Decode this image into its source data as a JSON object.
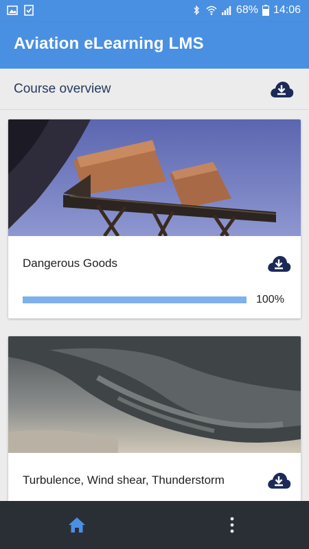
{
  "status_bar": {
    "battery": "68%",
    "time": "14:06",
    "left_icons": [
      "image-icon",
      "checkbox-icon"
    ],
    "right_icons": [
      "bluetooth-icon",
      "wifi-icon",
      "signal-icon",
      "battery-icon"
    ]
  },
  "app_bar": {
    "title": "Aviation eLearning LMS"
  },
  "overview": {
    "title": "Course overview",
    "download_icon": "cloud-download-icon"
  },
  "courses": [
    {
      "title": "Dangerous Goods",
      "progress": 1.0,
      "progress_label": "100%",
      "image": "cargo-loader-photo"
    },
    {
      "title": "Turbulence, Wind shear, Thunderstorm",
      "image": "storm-cloud-photo"
    }
  ],
  "bottom_nav": {
    "items": [
      "home-icon",
      "more-vert-icon"
    ]
  },
  "colors": {
    "primary": "#4a90e2",
    "accent_dark": "#1c2a57",
    "progress": "#7fb0ee",
    "nav_bg": "#2a2f36",
    "nav_active": "#4a90e2"
  }
}
